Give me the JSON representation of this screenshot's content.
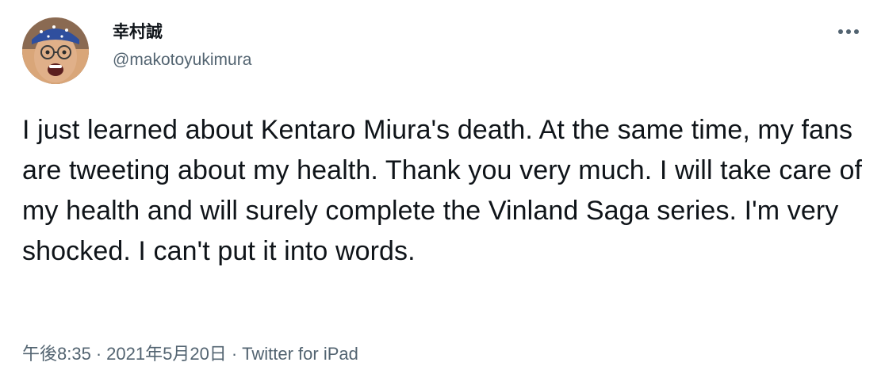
{
  "author": {
    "display_name": "幸村誠",
    "handle": "@makotoyukimura"
  },
  "tweet": {
    "text": "I just learned about Kentaro Miura's death. At the same time, my fans are tweeting about my health. Thank you very much. I will take care of my health and will surely complete the Vinland Saga series. I'm very shocked. I can't put it into words.",
    "time": "午後8:35",
    "date": "2021年5月20日",
    "separator": "·",
    "source": "Twitter for iPad"
  },
  "icons": {
    "more": "more-horizontal-icon",
    "avatar": "avatar-photo"
  },
  "colors": {
    "text_primary": "#0f1419",
    "text_secondary": "#536471",
    "background": "#ffffff"
  }
}
